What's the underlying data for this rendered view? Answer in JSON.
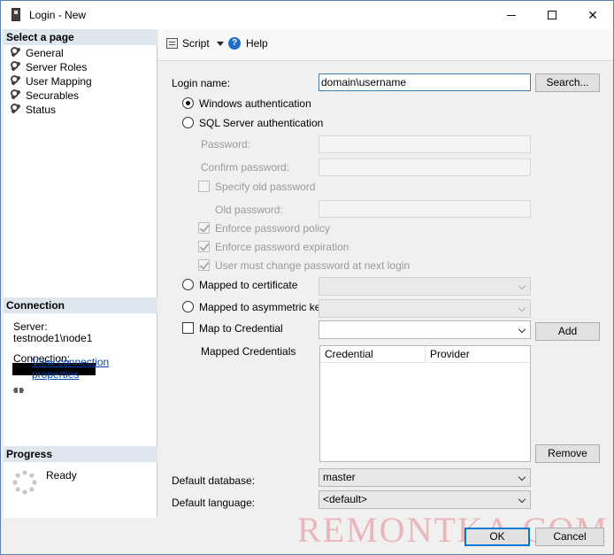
{
  "window": {
    "title": "Login - New"
  },
  "left": {
    "select_page_header": "Select a page",
    "pages": [
      "General",
      "Server Roles",
      "User Mapping",
      "Securables",
      "Status"
    ],
    "connection_header": "Connection",
    "server_label": "Server:",
    "server_value": "testnode1\\node1",
    "connection_label": "Connection:",
    "view_props_link": "View connection properties",
    "progress_header": "Progress",
    "progress_status": "Ready"
  },
  "toolbar": {
    "script_label": "Script",
    "help_label": "Help"
  },
  "form": {
    "login_name_label": "Login name:",
    "login_name_value": "domain\\username",
    "search_button": "Search...",
    "windows_auth": "Windows authentication",
    "sql_auth": "SQL Server authentication",
    "password_label": "Password:",
    "confirm_password_label": "Confirm password:",
    "specify_old_password": "Specify old password",
    "old_password_label": "Old password:",
    "enforce_policy": "Enforce password policy",
    "enforce_expiration": "Enforce password expiration",
    "must_change": "User must change password at next login",
    "mapped_cert": "Mapped to certificate",
    "mapped_asym": "Mapped to asymmetric key",
    "map_credential": "Map to Credential",
    "add_button": "Add",
    "mapped_credentials_label": "Mapped Credentials",
    "grid_columns": [
      "Credential",
      "Provider"
    ],
    "remove_button": "Remove",
    "default_db_label": "Default database:",
    "default_db_value": "master",
    "default_lang_label": "Default language:",
    "default_lang_value": "<default>"
  },
  "footer": {
    "ok_button": "OK",
    "cancel_button": "Cancel"
  },
  "watermark": "REMONTKA.COM"
}
